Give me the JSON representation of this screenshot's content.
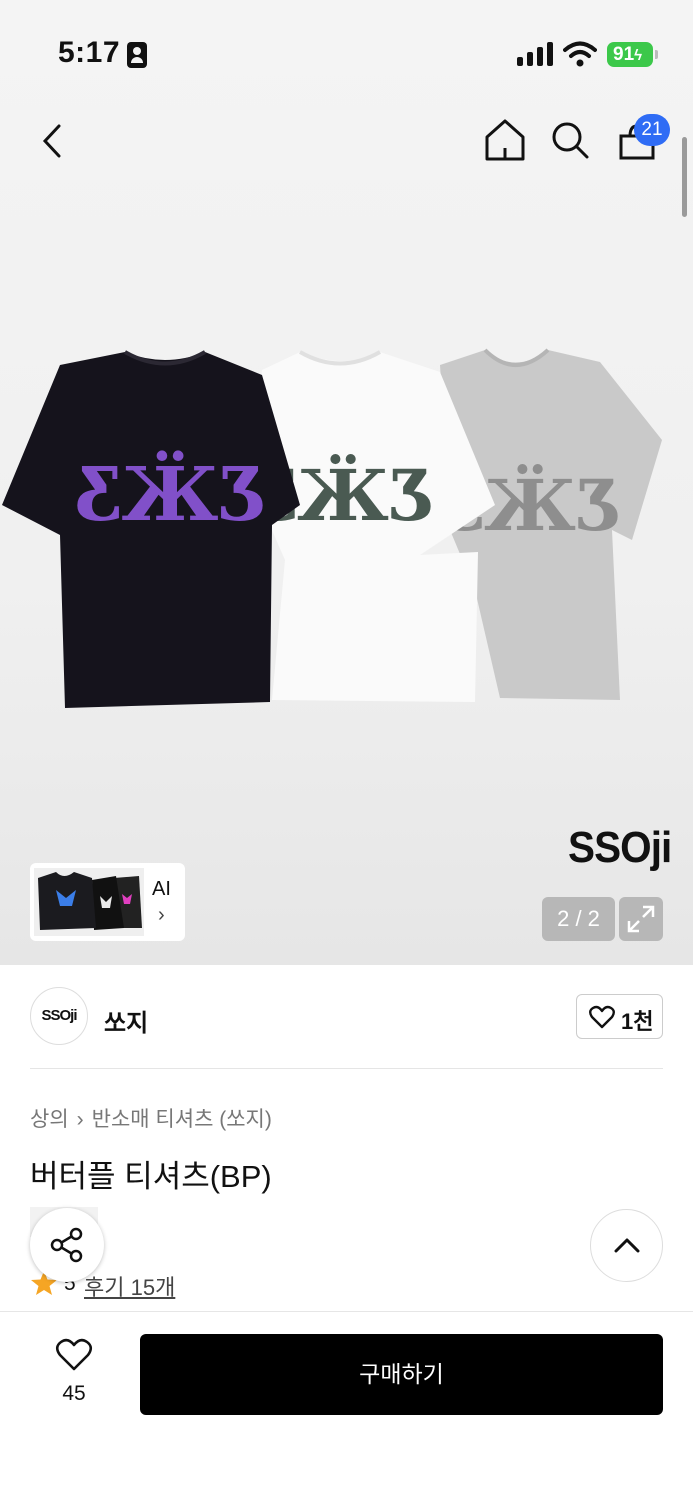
{
  "status_bar": {
    "time": "5:17",
    "battery": "91"
  },
  "nav": {
    "back_icon": "chevron-left-icon",
    "home_icon": "home-icon",
    "search_icon": "search-icon",
    "cart_icon": "bag-icon",
    "cart_count": "21"
  },
  "gallery": {
    "brand_watermark": "SSOji",
    "ai_label": "AI",
    "page_indicator": "2 / 2",
    "shirt_colors": [
      "#15131c",
      "#fafafa",
      "#c9c9c9"
    ],
    "print_colors": [
      "#8150c9",
      "#4a5a52",
      "#8e8e8e"
    ]
  },
  "brand": {
    "logo_text": "SSOji",
    "name": "쏘지",
    "likes": "1천"
  },
  "breadcrumb": [
    "상의",
    "반소매 티셔츠 (쏘지)"
  ],
  "product": {
    "title": "버터플 티셔츠(BP)",
    "rating": "5",
    "review_text": "후기 15개"
  },
  "bottom_bar": {
    "wish_count": "45",
    "buy_label": "구매하기"
  },
  "colors": {
    "accent_blue": "#2f6cf5",
    "buy_button": "#000000",
    "star": "#f5a524"
  }
}
